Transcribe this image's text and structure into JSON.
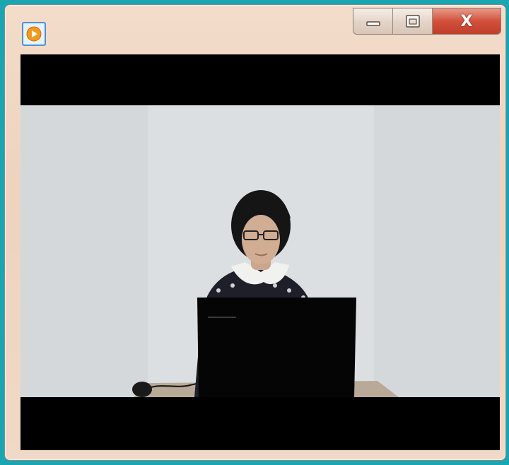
{
  "window": {
    "title": "",
    "icons": {
      "app": "play-icon",
      "minimize": "minimize-icon",
      "maximize": "maximize-icon",
      "close": "close-icon"
    },
    "close_label": "X"
  },
  "colors": {
    "desktop": "#1aa6b0",
    "frame": "#f0d9c6",
    "close_button": "#d3513b",
    "letterbox": "#000000"
  }
}
